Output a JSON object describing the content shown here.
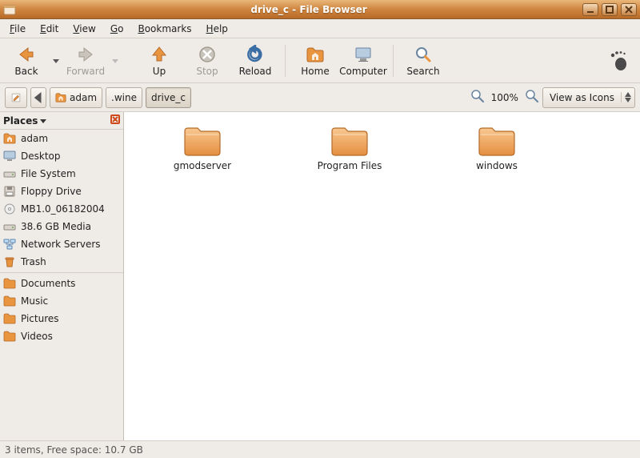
{
  "window": {
    "title": "drive_c - File Browser"
  },
  "menu": {
    "file": "File",
    "edit": "Edit",
    "view": "View",
    "go": "Go",
    "bookmarks": "Bookmarks",
    "help": "Help"
  },
  "toolbar": {
    "back": "Back",
    "forward": "Forward",
    "up": "Up",
    "stop": "Stop",
    "reload": "Reload",
    "home": "Home",
    "computer": "Computer",
    "search": "Search"
  },
  "path": {
    "segments": [
      {
        "label": "adam",
        "is_home": true,
        "active": false
      },
      {
        "label": ".wine",
        "is_home": false,
        "active": false
      },
      {
        "label": "drive_c",
        "is_home": false,
        "active": true
      }
    ]
  },
  "zoom": {
    "level": "100%"
  },
  "view_mode": {
    "selected": "View as Icons"
  },
  "sidebar": {
    "title": "Places",
    "items": [
      {
        "label": "adam",
        "icon": "home"
      },
      {
        "label": "Desktop",
        "icon": "desktop"
      },
      {
        "label": "File System",
        "icon": "drive"
      },
      {
        "label": "Floppy Drive",
        "icon": "floppy"
      },
      {
        "label": "MB1.0_06182004",
        "icon": "disc"
      },
      {
        "label": "38.6 GB Media",
        "icon": "drive"
      },
      {
        "label": "Network Servers",
        "icon": "network"
      },
      {
        "label": "Trash",
        "icon": "trash"
      }
    ],
    "bookmarks": [
      {
        "label": "Documents",
        "icon": "folder"
      },
      {
        "label": "Music",
        "icon": "folder"
      },
      {
        "label": "Pictures",
        "icon": "folder"
      },
      {
        "label": "Videos",
        "icon": "folder"
      }
    ]
  },
  "files": [
    {
      "name": "gmodserver",
      "type": "folder"
    },
    {
      "name": "Program Files",
      "type": "folder"
    },
    {
      "name": "windows",
      "type": "folder"
    }
  ],
  "status": {
    "text": "3 items, Free space: 10.7 GB"
  }
}
